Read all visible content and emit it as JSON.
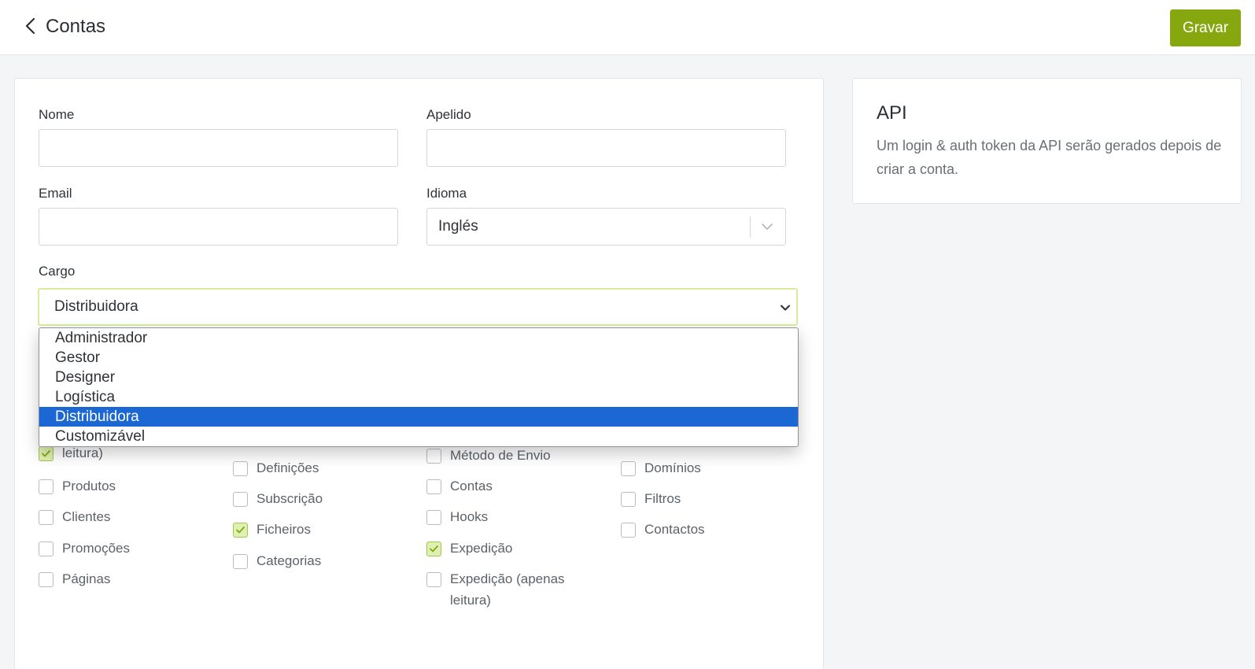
{
  "header": {
    "title": "Contas",
    "save_label": "Gravar"
  },
  "form": {
    "nome_label": "Nome",
    "nome_value": "",
    "apelido_label": "Apelido",
    "apelido_value": "",
    "email_label": "Email",
    "email_value": "",
    "idioma_label": "Idioma",
    "idioma_value": "Inglés",
    "cargo_label": "Cargo",
    "cargo_value": "Distribuidora",
    "cargo_options": [
      "Administrador",
      "Gestor",
      "Designer",
      "Logística",
      "Distribuidora",
      "Customizável"
    ],
    "cargo_selected_index": 4
  },
  "permissions": {
    "col1": [
      {
        "label": "leitura)",
        "checked": true
      },
      {
        "label": "Produtos",
        "checked": false
      },
      {
        "label": "Clientes",
        "checked": false
      },
      {
        "label": "Promoções",
        "checked": false
      },
      {
        "label": "Páginas",
        "checked": false
      }
    ],
    "col2": [
      {
        "label": "Definições",
        "checked": false
      },
      {
        "label": "Subscrição",
        "checked": false
      },
      {
        "label": "Ficheiros",
        "checked": true
      },
      {
        "label": "Categorias",
        "checked": false
      }
    ],
    "col3": [
      {
        "label": "Método de Envio",
        "checked": false
      },
      {
        "label": "Contas",
        "checked": false
      },
      {
        "label": "Hooks",
        "checked": false
      },
      {
        "label": "Expedição",
        "checked": true
      },
      {
        "label": "Expedição (apenas leitura)",
        "checked": false
      }
    ],
    "col4": [
      {
        "label": "Domínios",
        "checked": false
      },
      {
        "label": "Filtros",
        "checked": false
      },
      {
        "label": "Contactos",
        "checked": false
      }
    ]
  },
  "api": {
    "title": "API",
    "description": "Um login & auth token da API serão gerados depois de criar a conta."
  },
  "colors": {
    "accent": "#86a80e",
    "selection": "#1b67d4",
    "checkbox_on": "#dff0b3"
  }
}
